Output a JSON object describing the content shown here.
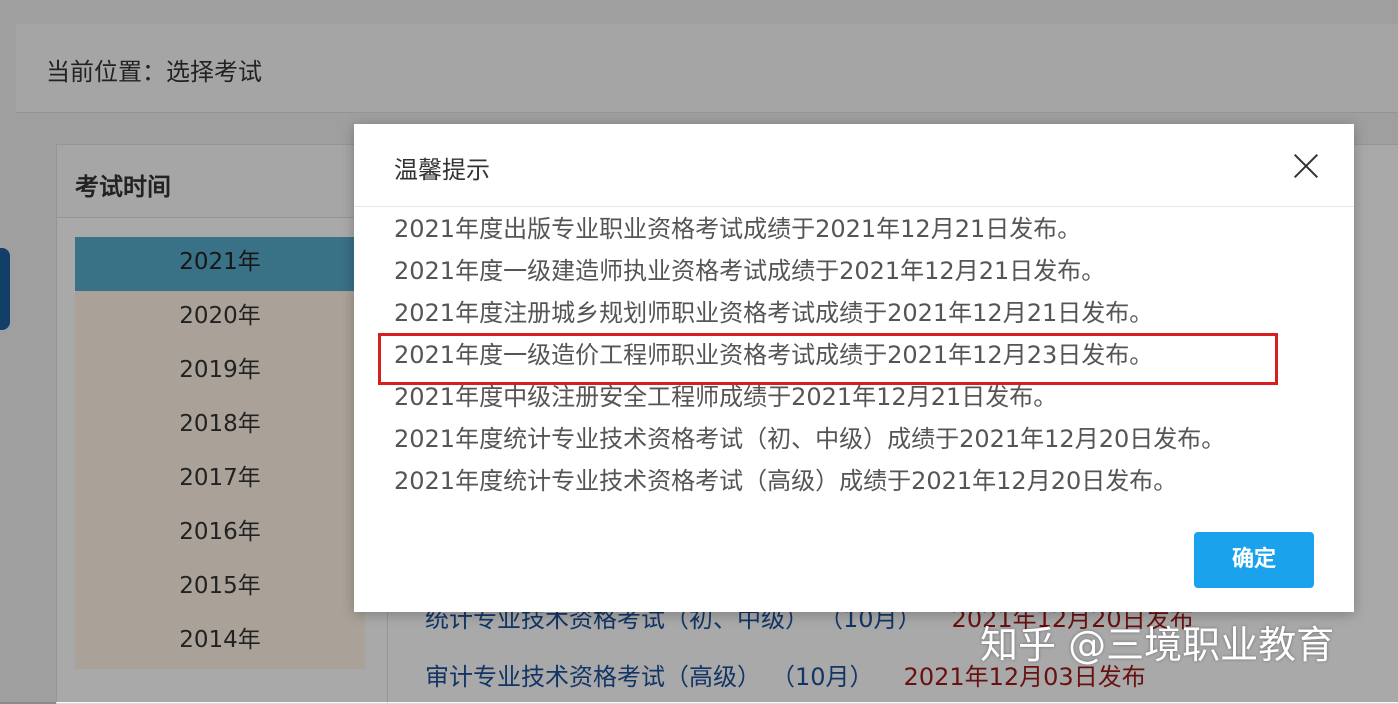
{
  "breadcrumb": {
    "text": "当前位置：选择考试"
  },
  "year_panel": {
    "header": "考试时间",
    "years": [
      "2021年",
      "2020年",
      "2019年",
      "2018年",
      "2017年",
      "2016年",
      "2015年",
      "2014年"
    ],
    "active_year": "2021年"
  },
  "exam_rows": [
    {
      "name": "统计专业技术资格考试（初、中级）",
      "month": "（10月）",
      "date": "2021年12月20日发布"
    },
    {
      "name": "审计专业技术资格考试（高级）",
      "month": "（10月）",
      "date": "2021年12月03日发布"
    }
  ],
  "dialog": {
    "title": "温馨提示",
    "close_icon": "close-icon",
    "notices": [
      "2021年度出版专业职业资格考试成绩于2021年12月21日发布。",
      "2021年度一级建造师执业资格考试成绩于2021年12月21日发布。",
      "2021年度注册城乡规划师职业资格考试成绩于2021年12月21日发布。",
      "2021年度一级造价工程师职业资格考试成绩于2021年12月23日发布。",
      "2021年度中级注册安全工程师成绩于2021年12月21日发布。",
      "2021年度统计专业技术资格考试（初、中级）成绩于2021年12月20日发布。",
      "2021年度统计专业技术资格考试（高级）成绩于2021年12月20日发布。"
    ],
    "confirm_label": "确定"
  },
  "watermark": "知乎 @三境职业教育",
  "colors": {
    "accent": "#1aa3ec",
    "highlight_border": "#d62020",
    "active_year_bg": "#55a7c7",
    "date_text": "#9b1a1a"
  }
}
